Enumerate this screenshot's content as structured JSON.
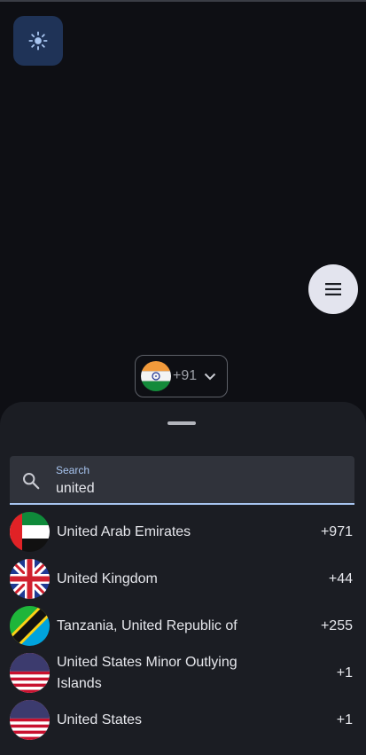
{
  "theme_toggle": {
    "icon": "sun-icon"
  },
  "menu_fab": {
    "icon": "menu-icon"
  },
  "phone_picker": {
    "flag": "india-flag-icon",
    "code": "+91",
    "chevron": "chevron-down-icon"
  },
  "sheet": {
    "search": {
      "label": "Search",
      "value": "united",
      "icon": "search-icon"
    },
    "countries": [
      {
        "name": "United Arab Emirates",
        "dial": "+971",
        "flag": "uae-flag-icon"
      },
      {
        "name": "United Kingdom",
        "dial": "+44",
        "flag": "uk-flag-icon"
      },
      {
        "name": "Tanzania, United Republic of",
        "dial": "+255",
        "flag": "tanzania-flag-icon"
      },
      {
        "name": "United States Minor Outlying Islands",
        "dial": "+1",
        "flag": "usa-flag-icon"
      },
      {
        "name": "United States",
        "dial": "+1",
        "flag": "usa-flag-icon"
      }
    ]
  },
  "colors": {
    "background": "#0e0f14",
    "sheet": "#1b1d23",
    "accent": "#a8c5f0"
  }
}
